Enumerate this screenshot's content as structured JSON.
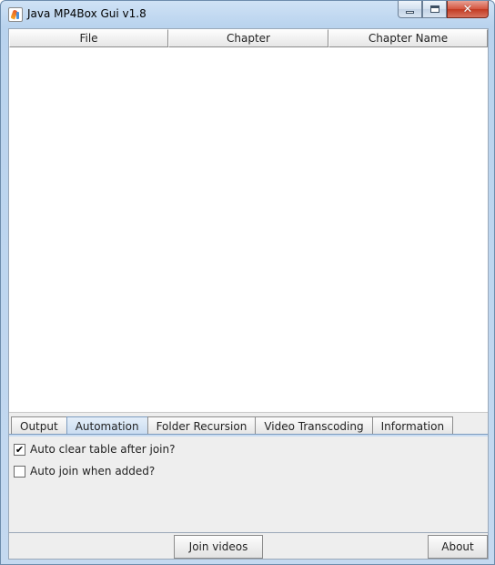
{
  "window": {
    "title": "Java MP4Box Gui v1.8",
    "controls": {
      "minimize_icon": "minimize-icon",
      "maximize_icon": "maximize-icon",
      "close_glyph": "✕"
    }
  },
  "table": {
    "columns": [
      "File",
      "Chapter",
      "Chapter Name"
    ],
    "rows": []
  },
  "tabs": {
    "items": [
      "Output",
      "Automation",
      "Folder Recursion",
      "Video Transcoding",
      "Information"
    ],
    "selected": "Automation"
  },
  "automation": {
    "auto_clear": {
      "label": "Auto clear table after join?",
      "checked": true,
      "mark": "✔"
    },
    "auto_join": {
      "label": "Auto join when added?",
      "checked": false,
      "mark": ""
    }
  },
  "buttons": {
    "join": "Join videos",
    "about": "About"
  },
  "colors": {
    "title_bar": "#b9d3ee",
    "active_tab": "#c9dcf1",
    "close_button": "#c23a22"
  }
}
